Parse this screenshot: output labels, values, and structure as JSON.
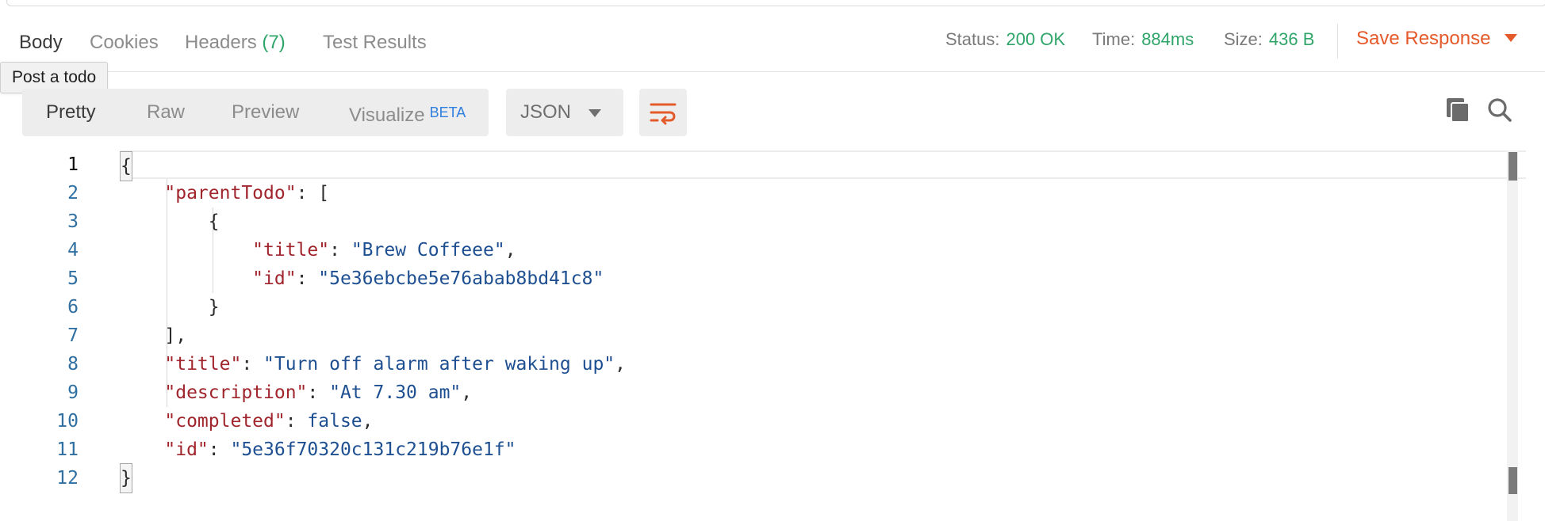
{
  "response_tabs": [
    {
      "label": "Body",
      "count": ""
    },
    {
      "label": "Cookies",
      "count": ""
    },
    {
      "label": "Headers",
      "count": "(7)"
    },
    {
      "label": "Test Results",
      "count": ""
    }
  ],
  "status": {
    "status_label": "Status:",
    "status_value": "200 OK",
    "time_label": "Time:",
    "time_value": "884ms",
    "size_label": "Size:",
    "size_value": "436 B"
  },
  "save_response": {
    "label": "Save Response"
  },
  "tooltip": {
    "text": "Post a todo"
  },
  "view_modes": {
    "pretty": "Pretty",
    "raw": "Raw",
    "preview": "Preview",
    "visualize": "Visualize",
    "beta": "BETA"
  },
  "format_select": {
    "value": "JSON"
  },
  "icons": {
    "wrap": "wrap-lines-icon",
    "copy": "copy-icon",
    "search": "search-icon"
  },
  "colors": {
    "accent_orange": "#e55a2b",
    "status_green": "#2fa56a",
    "json_key": "#a0252c",
    "json_string": "#1d4f91",
    "line_number": "#2f6fa1",
    "beta_blue": "#2f7fe0"
  },
  "editor": {
    "line_numbers": [
      "1",
      "2",
      "3",
      "4",
      "5",
      "6",
      "7",
      "8",
      "9",
      "10",
      "11",
      "12"
    ],
    "line1": {
      "text": "{"
    },
    "line2": {
      "key": "\"parentTodo\"",
      "rest": ": ["
    },
    "line3": {
      "text": "{"
    },
    "line4": {
      "key": "\"title\"",
      "sep": ": ",
      "value": "\"Brew Coffeee\"",
      "tail": ","
    },
    "line5": {
      "key": "\"id\"",
      "sep": ": ",
      "value": "\"5e36ebcbe5e76abab8bd41c8\"",
      "tail": ""
    },
    "line6": {
      "text": "}"
    },
    "line7": {
      "text": "],"
    },
    "line8": {
      "key": "\"title\"",
      "sep": ": ",
      "value": "\"Turn off alarm after waking up\"",
      "tail": ","
    },
    "line9": {
      "key": "\"description\"",
      "sep": ": ",
      "value": "\"At 7.30 am\"",
      "tail": ","
    },
    "line10": {
      "key": "\"completed\"",
      "sep": ": ",
      "value": "false",
      "tail": ","
    },
    "line11": {
      "key": "\"id\"",
      "sep": ": ",
      "value": "\"5e36f70320c131c219b76e1f\"",
      "tail": ""
    },
    "line12": {
      "text": "}"
    }
  }
}
